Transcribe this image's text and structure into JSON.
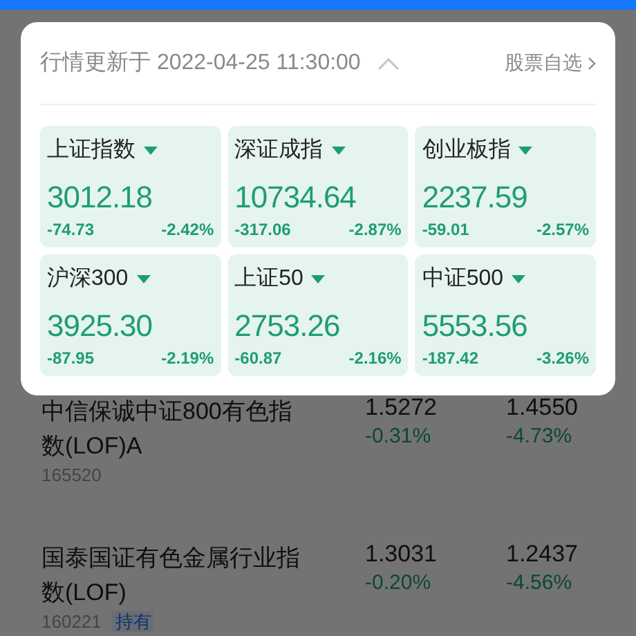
{
  "popup": {
    "updated_label": "行情更新于 2022-04-25 11:30:00",
    "expanded": true,
    "watchlist_link": "股票自选",
    "indices": [
      {
        "name": "上证指数",
        "falling": true,
        "value": "3012.18",
        "change": "-74.73",
        "percent": "-2.42%"
      },
      {
        "name": "深证成指",
        "falling": true,
        "value": "10734.64",
        "change": "-317.06",
        "percent": "-2.87%"
      },
      {
        "name": "创业板指",
        "falling": true,
        "value": "2237.59",
        "change": "-59.01",
        "percent": "-2.57%"
      },
      {
        "name": "沪深300",
        "falling": true,
        "value": "3925.30",
        "change": "-87.95",
        "percent": "-2.19%"
      },
      {
        "name": "上证50",
        "falling": true,
        "value": "2753.26",
        "change": "-60.87",
        "percent": "-2.16%"
      },
      {
        "name": "中证500",
        "falling": true,
        "value": "5553.56",
        "change": "-187.42",
        "percent": "-3.26%"
      }
    ]
  },
  "funds": [
    {
      "name": "中信保诚中证800有色指数(LOF)A",
      "code": "165520",
      "value_1": "1.5272",
      "change_1": "-0.31%",
      "value_2": "1.4550",
      "change_2": "-4.73%"
    },
    {
      "name": "国泰国证有色金属行业指数(LOF)",
      "code": "160221",
      "tag": "持有",
      "value_1": "1.3031",
      "change_1": "-0.20%",
      "value_2": "1.2437",
      "change_2": "-4.56%"
    }
  ]
}
